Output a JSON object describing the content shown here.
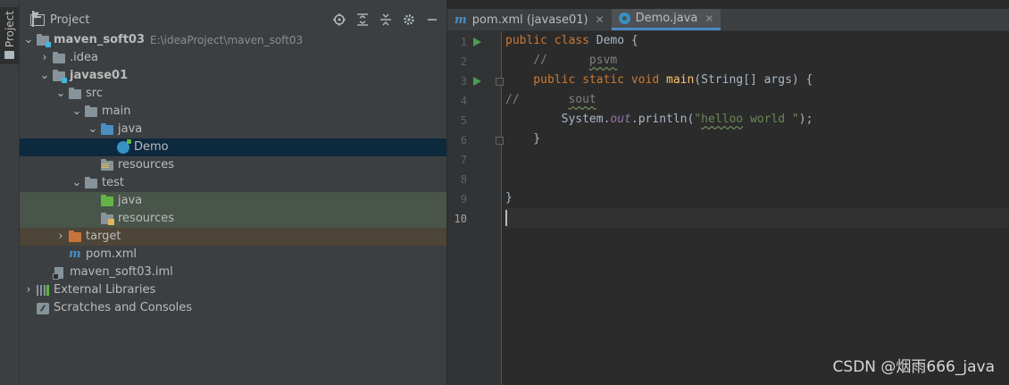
{
  "sidebar_strip": {
    "tab_label": "Project"
  },
  "panel": {
    "title": "Project",
    "tools": [
      "locate-icon",
      "expand-all-icon",
      "collapse-all-icon",
      "gear-icon",
      "minimize-icon"
    ]
  },
  "tree": {
    "root": {
      "name": "maven_soft03",
      "path": "E:\\ideaProject\\maven_soft03"
    },
    "idea": "idea",
    "idea_prefix": ".",
    "javase01": "javase01",
    "src": "src",
    "main": "main",
    "main_java": "java",
    "demo": "Demo",
    "main_resources": "resources",
    "test": "test",
    "test_java": "java",
    "test_resources": "resources",
    "target": "target",
    "pom": "pom.xml",
    "iml": "maven_soft03.iml",
    "external_libraries": "External Libraries",
    "scratches": "Scratches and Consoles"
  },
  "tabs": [
    {
      "label": "pom.xml (javase01)",
      "icon": "maven-icon",
      "active": false
    },
    {
      "label": "Demo.java",
      "icon": "class-icon",
      "active": true
    }
  ],
  "editor": {
    "line_numbers": [
      "1",
      "2",
      "3",
      "4",
      "5",
      "6",
      "7",
      "8",
      "9",
      "10"
    ],
    "current_line": "10",
    "code": {
      "l1_kw": "public class ",
      "l1_rest": "Demo {",
      "l2_comment": "    //      ",
      "l2_word": "psvm",
      "l3_kw": "    public static void ",
      "l3_fn": "main",
      "l3_rest": "(String[] args) {",
      "l4_comment": "//       ",
      "l4_word": "sout",
      "l5_a": "        System.",
      "l5_field": "out",
      "l5_b": ".println(",
      "l5_q1": "\"",
      "l5_str_word": "helloo",
      "l5_str_rest": " world \"",
      "l5_c": ");",
      "l6": "    }",
      "l9": "}"
    }
  },
  "watermark": "CSDN @烟雨666_java"
}
